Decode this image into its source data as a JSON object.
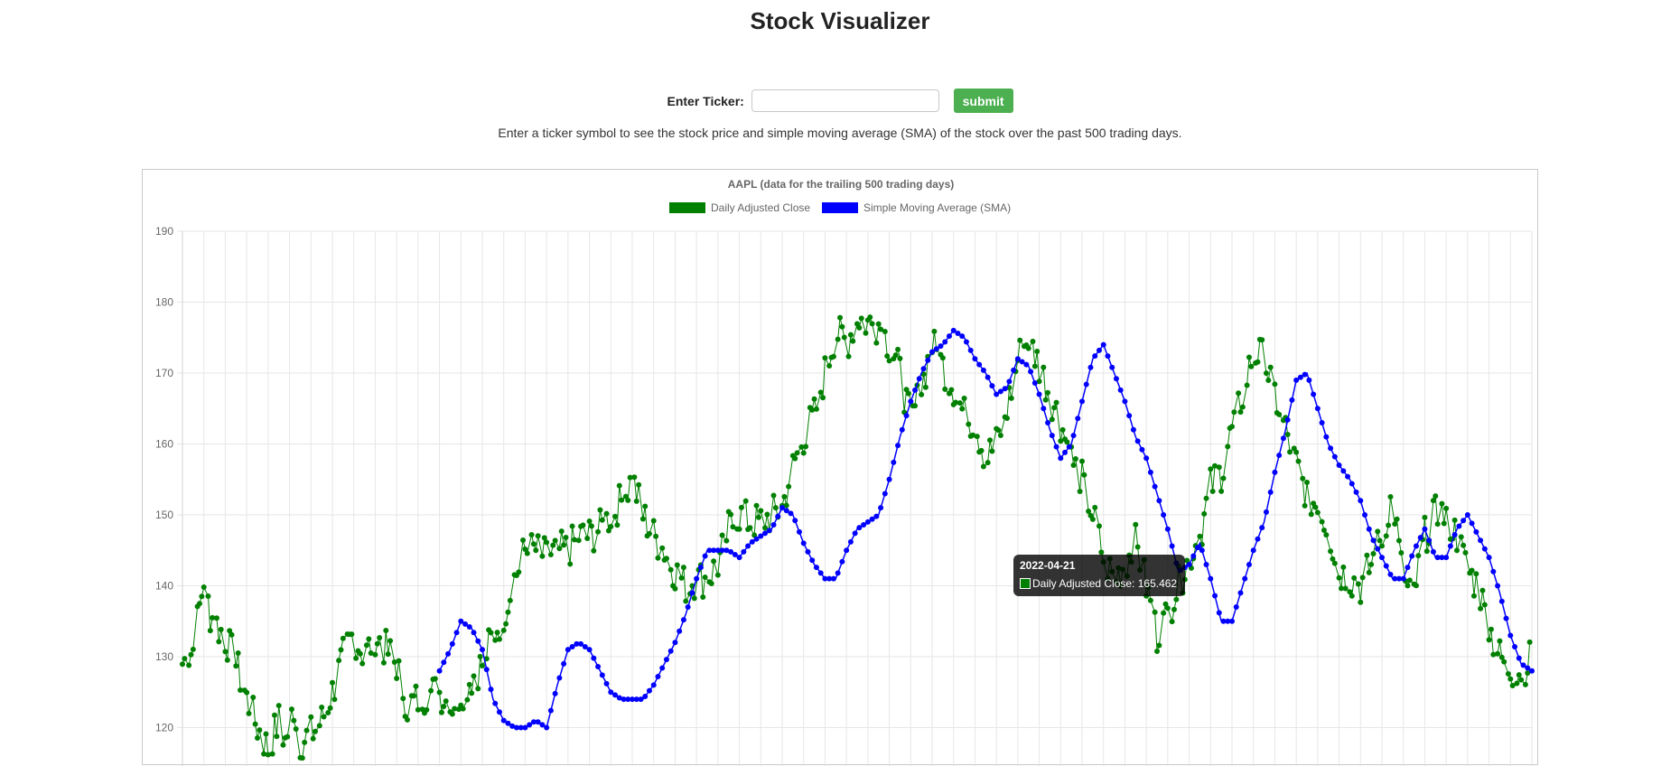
{
  "page": {
    "title": "Stock Visualizer",
    "form": {
      "label": "Enter Ticker:",
      "input_value": "",
      "submit_label": "submit"
    },
    "description": "Enter a ticker symbol to see the stock price and simple moving average (SMA) of the stock over the past 500 trading days."
  },
  "tooltip": {
    "title": "2022-04-21",
    "label": "Daily Adjusted Close: 165.462"
  },
  "chart_data": {
    "type": "line",
    "title": "AAPL (data for the trailing 500 trading days)",
    "legend_position": "top",
    "grid": true,
    "ylim": [
      120,
      190
    ],
    "yticks": [
      190,
      180,
      170,
      160,
      150,
      140,
      130,
      120
    ],
    "n_points": 500,
    "series": [
      {
        "name": "Daily Adjusted Close",
        "color": "#008000",
        "anchors": [
          [
            0,
            129
          ],
          [
            5,
            131
          ],
          [
            10,
            141
          ],
          [
            13,
            136
          ],
          [
            17,
            134
          ],
          [
            21,
            132
          ],
          [
            25,
            129
          ],
          [
            30,
            124
          ],
          [
            35,
            120
          ],
          [
            40,
            117
          ],
          [
            45,
            121
          ],
          [
            48,
            118
          ],
          [
            52,
            123
          ],
          [
            55,
            118
          ],
          [
            60,
            119
          ],
          [
            65,
            121
          ],
          [
            70,
            125
          ],
          [
            75,
            130
          ],
          [
            80,
            133
          ],
          [
            85,
            130
          ],
          [
            90,
            133
          ],
          [
            95,
            131
          ],
          [
            100,
            129
          ],
          [
            105,
            123
          ],
          [
            110,
            124
          ],
          [
            115,
            125
          ],
          [
            120,
            125
          ],
          [
            125,
            123
          ],
          [
            130,
            125
          ],
          [
            135,
            127
          ],
          [
            140,
            129
          ],
          [
            145,
            133
          ],
          [
            150,
            136
          ],
          [
            155,
            141
          ],
          [
            160,
            145
          ],
          [
            165,
            145
          ],
          [
            170,
            144
          ],
          [
            175,
            145
          ],
          [
            180,
            145
          ],
          [
            185,
            147
          ],
          [
            190,
            147
          ],
          [
            195,
            148
          ],
          [
            200,
            150
          ],
          [
            205,
            152
          ],
          [
            210,
            155
          ],
          [
            215,
            150
          ],
          [
            220,
            147
          ],
          [
            225,
            145
          ],
          [
            230,
            142
          ],
          [
            235,
            140
          ],
          [
            240,
            141
          ],
          [
            245,
            141
          ],
          [
            250,
            143
          ],
          [
            255,
            148
          ],
          [
            260,
            150
          ],
          [
            265,
            149
          ],
          [
            270,
            149
          ],
          [
            275,
            150
          ],
          [
            280,
            151
          ],
          [
            285,
            157
          ],
          [
            290,
            161
          ],
          [
            295,
            164
          ],
          [
            300,
            170
          ],
          [
            305,
            176
          ],
          [
            310,
            174
          ],
          [
            315,
            178
          ],
          [
            320,
            177
          ],
          [
            325,
            177
          ],
          [
            330,
            174
          ],
          [
            335,
            170
          ],
          [
            340,
            163
          ],
          [
            345,
            168
          ],
          [
            350,
            174
          ],
          [
            355,
            171
          ],
          [
            360,
            168
          ],
          [
            365,
            164
          ],
          [
            370,
            163
          ],
          [
            375,
            158
          ],
          [
            380,
            160
          ],
          [
            385,
            165
          ],
          [
            390,
            172
          ],
          [
            395,
            175
          ],
          [
            400,
            171
          ],
          [
            405,
            167
          ],
          [
            410,
            163
          ],
          [
            415,
            158
          ],
          [
            420,
            155
          ],
          [
            425,
            150
          ],
          [
            430,
            144
          ],
          [
            435,
            141
          ],
          [
            440,
            143
          ],
          [
            445,
            146
          ],
          [
            450,
            140
          ],
          [
            455,
            133
          ],
          [
            460,
            136
          ],
          [
            465,
            140
          ],
          [
            470,
            144
          ],
          [
            475,
            147
          ],
          [
            480,
            154
          ],
          [
            485,
            156
          ],
          [
            490,
            162
          ],
          [
            495,
            167
          ],
          [
            500,
            173
          ],
          [
            505,
            172
          ],
          [
            510,
            167
          ],
          [
            515,
            162
          ],
          [
            520,
            157
          ],
          [
            525,
            153
          ],
          [
            530,
            151
          ],
          [
            535,
            148
          ],
          [
            540,
            142
          ],
          [
            545,
            141
          ],
          [
            550,
            140
          ],
          [
            555,
            143
          ],
          [
            560,
            147
          ],
          [
            565,
            153
          ],
          [
            570,
            140
          ],
          [
            575,
            139
          ],
          [
            580,
            147
          ],
          [
            585,
            150
          ],
          [
            590,
            150
          ],
          [
            595,
            147
          ],
          [
            600,
            142
          ],
          [
            605,
            140
          ],
          [
            610,
            134
          ],
          [
            615,
            130
          ],
          [
            620,
            128
          ],
          [
            625,
            128
          ],
          [
            630,
            130
          ]
        ]
      },
      {
        "name": "Simple Moving Average (SMA)",
        "color": "#0000ff",
        "anchors": [
          [
            0,
            128
          ],
          [
            5,
            131
          ],
          [
            10,
            135
          ],
          [
            15,
            134
          ],
          [
            20,
            131
          ],
          [
            25,
            124
          ],
          [
            30,
            121
          ],
          [
            35,
            120
          ],
          [
            40,
            120
          ],
          [
            45,
            121
          ],
          [
            50,
            120
          ],
          [
            55,
            126
          ],
          [
            60,
            131
          ],
          [
            65,
            132
          ],
          [
            70,
            131
          ],
          [
            75,
            128
          ],
          [
            80,
            125
          ],
          [
            85,
            124
          ],
          [
            90,
            124
          ],
          [
            95,
            124
          ],
          [
            100,
            126
          ],
          [
            105,
            129
          ],
          [
            110,
            132
          ],
          [
            115,
            136
          ],
          [
            120,
            141
          ],
          [
            125,
            145
          ],
          [
            130,
            145
          ],
          [
            135,
            145
          ],
          [
            140,
            144
          ],
          [
            145,
            146
          ],
          [
            150,
            147
          ],
          [
            155,
            148
          ],
          [
            160,
            151
          ],
          [
            165,
            150
          ],
          [
            170,
            146
          ],
          [
            175,
            143
          ],
          [
            180,
            141
          ],
          [
            185,
            141
          ],
          [
            190,
            145
          ],
          [
            195,
            148
          ],
          [
            200,
            149
          ],
          [
            205,
            150
          ],
          [
            210,
            155
          ],
          [
            215,
            161
          ],
          [
            220,
            166
          ],
          [
            225,
            170
          ],
          [
            230,
            173
          ],
          [
            235,
            174
          ],
          [
            240,
            176
          ],
          [
            245,
            175
          ],
          [
            250,
            172
          ],
          [
            255,
            170
          ],
          [
            260,
            167
          ],
          [
            265,
            168
          ],
          [
            270,
            172
          ],
          [
            275,
            171
          ],
          [
            280,
            167
          ],
          [
            285,
            162
          ],
          [
            290,
            158
          ],
          [
            295,
            160
          ],
          [
            300,
            166
          ],
          [
            305,
            172
          ],
          [
            310,
            174
          ],
          [
            315,
            170
          ],
          [
            320,
            166
          ],
          [
            325,
            161
          ],
          [
            330,
            158
          ],
          [
            335,
            153
          ],
          [
            340,
            148
          ],
          [
            345,
            142
          ],
          [
            350,
            143
          ],
          [
            355,
            146
          ],
          [
            360,
            141
          ],
          [
            365,
            135
          ],
          [
            370,
            135
          ],
          [
            375,
            140
          ],
          [
            380,
            145
          ],
          [
            385,
            149
          ],
          [
            390,
            156
          ],
          [
            395,
            162
          ],
          [
            400,
            169
          ],
          [
            405,
            170
          ],
          [
            410,
            165
          ],
          [
            415,
            160
          ],
          [
            420,
            157
          ],
          [
            425,
            155
          ],
          [
            430,
            152
          ],
          [
            435,
            147
          ],
          [
            440,
            144
          ],
          [
            445,
            141
          ],
          [
            450,
            141
          ],
          [
            455,
            145
          ],
          [
            460,
            148
          ],
          [
            465,
            144
          ],
          [
            470,
            144
          ],
          [
            475,
            148
          ],
          [
            480,
            150
          ],
          [
            485,
            147
          ],
          [
            490,
            144
          ],
          [
            495,
            139
          ],
          [
            500,
            133
          ],
          [
            505,
            129
          ],
          [
            510,
            128
          ]
        ]
      }
    ]
  }
}
